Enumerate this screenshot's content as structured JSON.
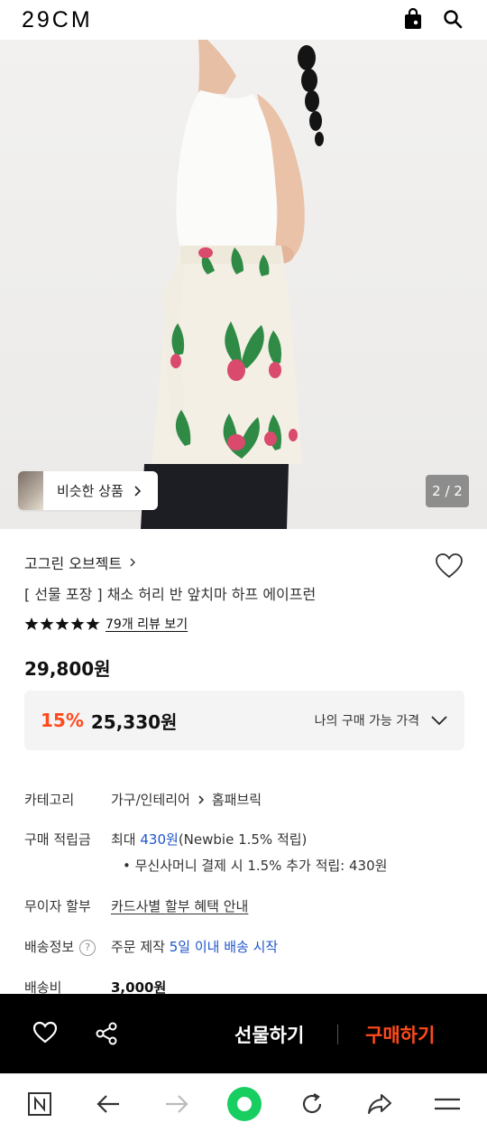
{
  "header": {
    "logo": "29CM",
    "icons": [
      "shopping-bag-icon",
      "search-icon"
    ]
  },
  "hero": {
    "similar_label": "비슷한 상품",
    "pager": "2 / 2"
  },
  "product": {
    "brand": "고그린 오브젝트",
    "name": "[ 선물 포장 ] 채소 허리 반 앞치마 하프 에이프런",
    "rating_stars": 5,
    "review_link": "79개 리뷰 보기",
    "price": "29,800원",
    "discount_rate": "15%",
    "discount_price": "25,330원",
    "my_price_label": "나의 구매 가능 가격"
  },
  "info": {
    "category_label": "카테고리",
    "category_value_1": "가구/인테리어",
    "category_value_2": "홈패브릭",
    "points_label": "구매 적립금",
    "points_prefix": "최대 ",
    "points_amount": "430원",
    "points_suffix": "(Newbie 1.5% 적립)",
    "points_sub": "• 무신사머니 결제 시 1.5% 추가 적립: 430원",
    "installment_label": "무이자 할부",
    "installment_value": "카드사별 할부 혜택 안내",
    "shipping_label": "배송정보",
    "shipping_prefix": "주문 제작 ",
    "shipping_highlight": "5일 이내 배송 시작",
    "fee_label": "배송비",
    "fee_value": "3,000원"
  },
  "action_bar": {
    "gift_label": "선물하기",
    "buy_label": "구매하기"
  },
  "colors": {
    "accent": "#ff4a1c",
    "link_blue": "#1f56c9",
    "bar": "#000000"
  }
}
